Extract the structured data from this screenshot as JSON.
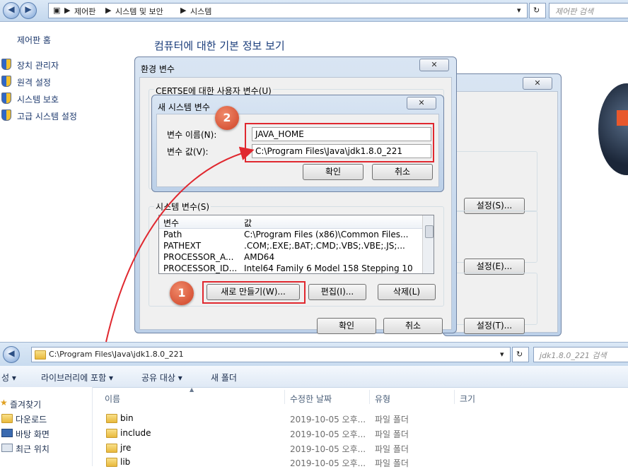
{
  "control_panel": {
    "breadcrumb": [
      "제어판",
      "시스템 및 보안",
      "시스템"
    ],
    "search_placeholder": "제어판 검색",
    "home": "제어판 홈",
    "links": [
      "장치 관리자",
      "원격 설정",
      "시스템 보호",
      "고급 시스템 설정"
    ],
    "title": "컴퓨터에 대한 기본 정보 보기"
  },
  "sys_props": {
    "settings_buttons": [
      "설정(S)...",
      "설정(E)...",
      "설정(T)..."
    ]
  },
  "env_dialog": {
    "title": "환경 변수",
    "user_vars_label": "CERTSE에 대한 사용자 변수(U)",
    "system_vars_label": "시스템 변수(S)",
    "columns": [
      "변수",
      "값"
    ],
    "rows": [
      {
        "name": "Path",
        "value": "C:\\Program Files (x86)\\Common Files..."
      },
      {
        "name": "PATHEXT",
        "value": ".COM;.EXE;.BAT;.CMD;.VBS;.VBE;.JS;..."
      },
      {
        "name": "PROCESSOR_A...",
        "value": "AMD64"
      },
      {
        "name": "PROCESSOR_ID...",
        "value": "Intel64 Family 6 Model 158 Stepping 10"
      }
    ],
    "new_button": "새로 만들기(W)...",
    "edit_button": "편집(I)...",
    "delete_button": "삭제(L)",
    "ok_button": "확인",
    "cancel_button": "취소"
  },
  "new_var_dialog": {
    "title": "새 시스템 변수",
    "name_label": "변수 이름(N):",
    "value_label": "변수 값(V):",
    "name_value": "JAVA_HOME",
    "value_value": "C:\\Program Files\\Java\\jdk1.8.0_221",
    "ok": "확인",
    "cancel": "취소"
  },
  "badges": [
    "1",
    "2"
  ],
  "explorer": {
    "address": "C:\\Program Files\\Java\\jdk1.8.0_221",
    "search_placeholder": "jdk1.8.0_221 검색",
    "toolbar": [
      "성 ▾",
      "라이브러리에 포함 ▾",
      "공유 대상 ▾",
      "새 폴더"
    ],
    "columns": [
      "이름",
      "수정한 날짜",
      "유형",
      "크기"
    ],
    "nav": [
      "즐겨찾기",
      "다운로드",
      "바탕 화면",
      "최근 위치"
    ],
    "rows": [
      {
        "name": "bin",
        "date": "2019-10-05 오후...",
        "type": "파일 폴더"
      },
      {
        "name": "include",
        "date": "2019-10-05 오후...",
        "type": "파일 폴더"
      },
      {
        "name": "jre",
        "date": "2019-10-05 오후...",
        "type": "파일 폴더"
      },
      {
        "name": "lib",
        "date": "2019-10-05 오후...",
        "type": "파일 폴더"
      }
    ]
  },
  "colors": {
    "highlight": "#e0282f",
    "badge": "#d8573a",
    "link": "#1e3a6e"
  }
}
